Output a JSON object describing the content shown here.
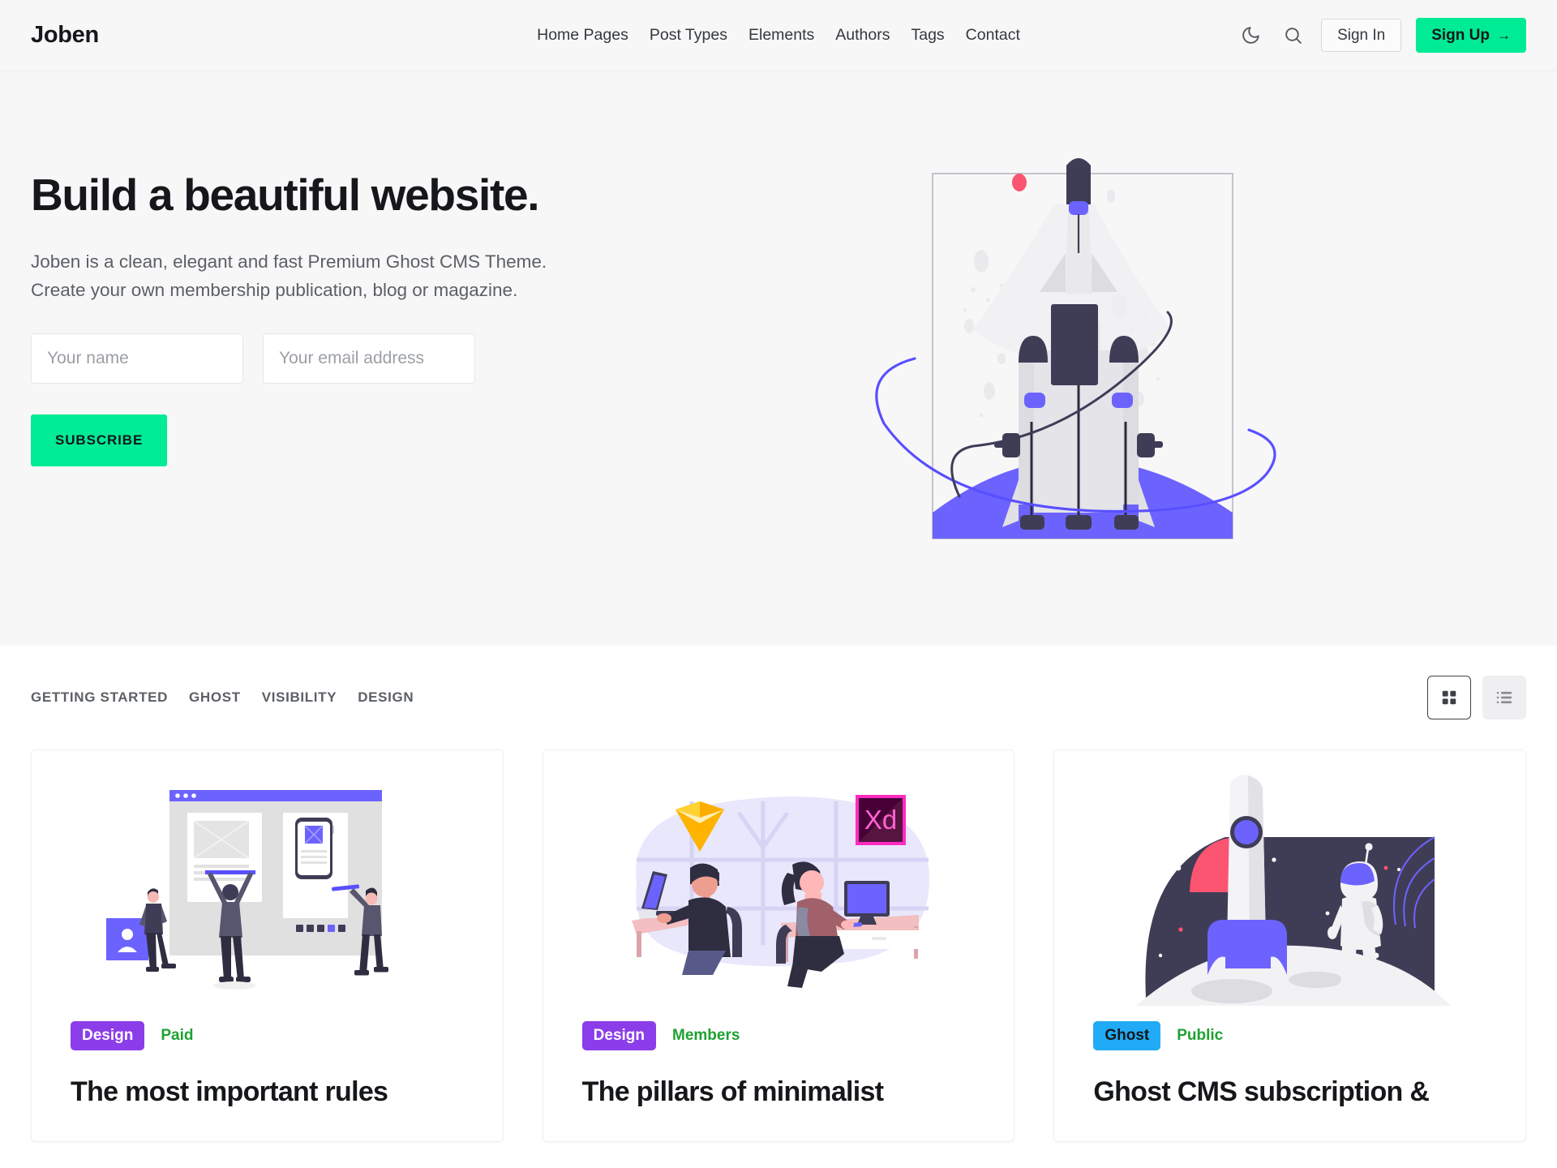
{
  "header": {
    "logo": "Joben",
    "nav": [
      {
        "label": "Home Pages"
      },
      {
        "label": "Post Types"
      },
      {
        "label": "Elements"
      },
      {
        "label": "Authors"
      },
      {
        "label": "Tags"
      },
      {
        "label": "Contact"
      }
    ],
    "dark_mode_icon": "moon-icon",
    "search_icon": "search-icon",
    "signin_label": "Sign In",
    "signup_label": "Sign Up",
    "signup_arrow": "→"
  },
  "hero": {
    "title": "Build a beautiful website.",
    "subtitle": "Joben is a clean, elegant and fast Premium Ghost CMS Theme. Create your own membership publication, blog or magazine.",
    "name_placeholder": "Your name",
    "name_value": "",
    "email_placeholder": "Your email address",
    "email_value": "",
    "subscribe_label": "SUBSCRIBE",
    "illustration": "rocket-launch-illustration"
  },
  "posts_section": {
    "filters": [
      {
        "label": "GETTING STARTED"
      },
      {
        "label": "GHOST"
      },
      {
        "label": "VISIBILITY"
      },
      {
        "label": "DESIGN"
      }
    ],
    "view_toggle": {
      "grid_icon": "grid-view-icon",
      "list_icon": "list-view-icon",
      "active": "grid"
    },
    "cards": [
      {
        "tag": "Design",
        "tag_color": "#8B3DEA",
        "tag_text_color": "#ffffff",
        "visibility": "Paid",
        "title": "The most important rules",
        "illustration": "web-design-team-illustration"
      },
      {
        "tag": "Design",
        "tag_color": "#8B3DEA",
        "tag_text_color": "#ffffff",
        "visibility": "Members",
        "title": "The pillars of minimalist",
        "illustration": "designers-at-desk-illustration"
      },
      {
        "tag": "Ghost",
        "tag_color": "#21AAF5",
        "tag_text_color": "#15171a",
        "visibility": "Public",
        "title": "Ghost CMS subscription &",
        "illustration": "astronaut-on-moon-illustration"
      }
    ]
  },
  "colors": {
    "accent_green": "#00eb95",
    "hero_background": "#f7f7f8",
    "text_primary": "#15171a",
    "text_muted": "#5c6066",
    "illustration_purple": "#6C63FF",
    "illustration_dark": "#3F3D56"
  }
}
